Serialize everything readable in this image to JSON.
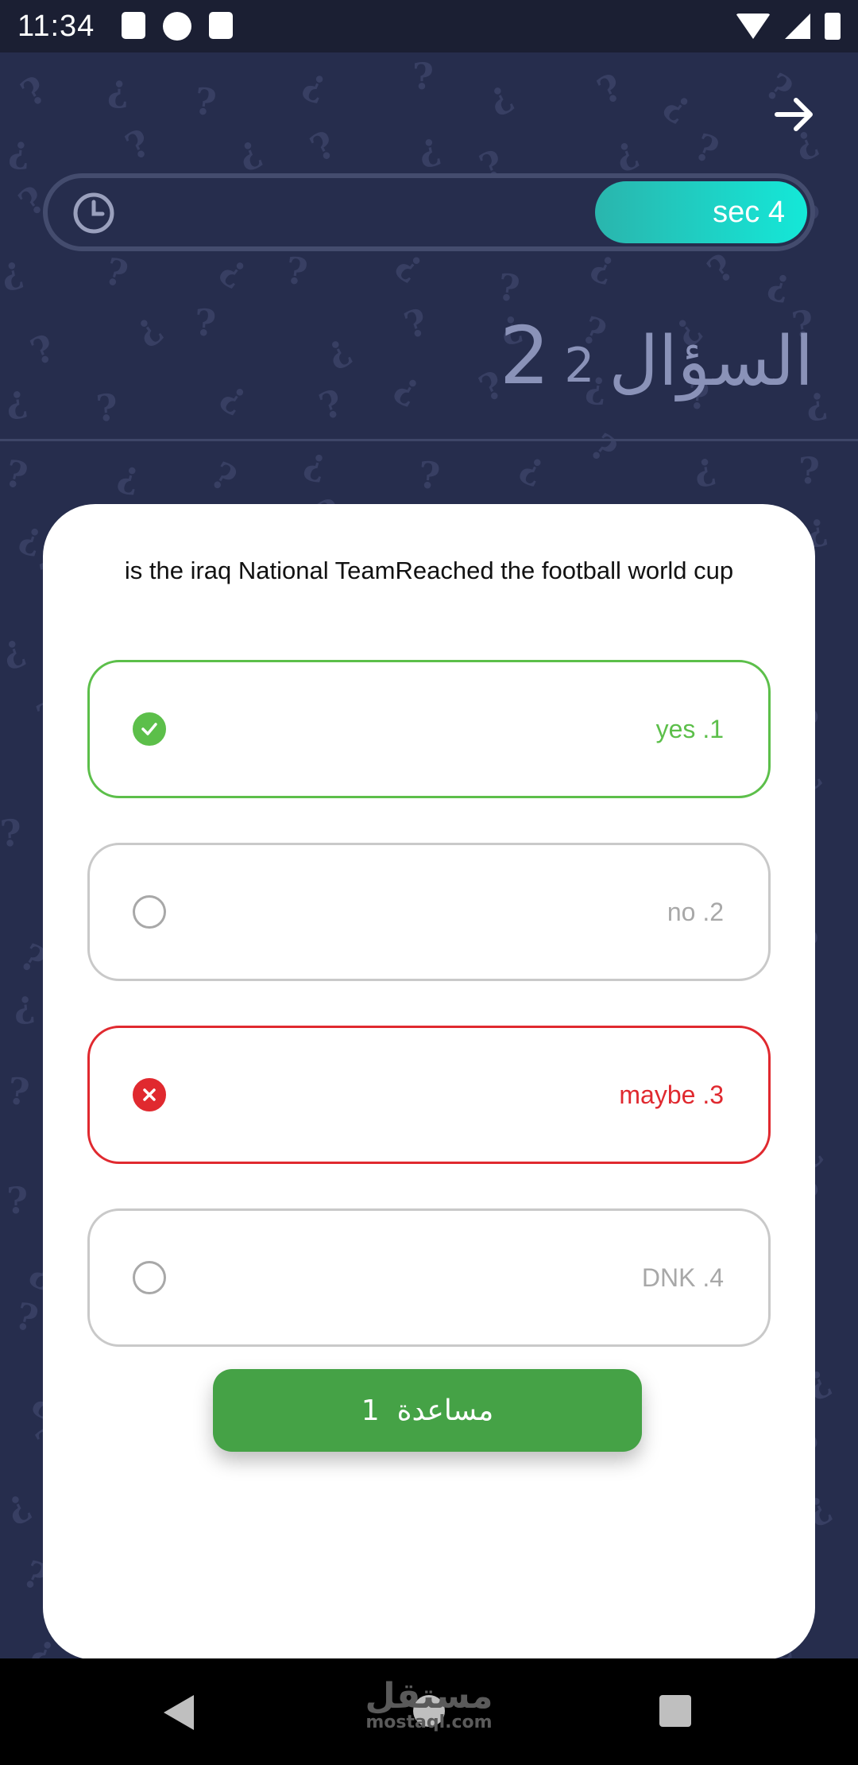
{
  "status_bar": {
    "time": "11:34",
    "icons_left": [
      "text-a-icon",
      "notification-icon",
      "sd-card-icon"
    ],
    "icons_right": [
      "wifi-icon",
      "signal-icon",
      "battery-icon"
    ]
  },
  "header": {
    "back_icon": "arrow-right-icon",
    "timer_icon": "clock-icon",
    "timer_label": "sec 4",
    "timer_fraction_remaining": 0.28,
    "question_word": "السؤال",
    "question_current": "2",
    "question_total": "2"
  },
  "question": {
    "text": "is the iraq National TeamReached the football world cup"
  },
  "answers": [
    {
      "label": "yes .1",
      "state": "correct",
      "mark_icon": "check-icon"
    },
    {
      "label": "no .2",
      "state": "neutral",
      "mark_icon": "empty-radio-icon"
    },
    {
      "label": "maybe .3",
      "state": "wrong",
      "mark_icon": "close-icon"
    },
    {
      "label": "DNK .4",
      "state": "neutral",
      "mark_icon": "empty-radio-icon"
    }
  ],
  "help_button": {
    "label": "مساعدة",
    "count": "1"
  },
  "colors": {
    "background": "#262d4d",
    "correct": "#5cbf4a",
    "wrong": "#e0292f",
    "help": "#45a246",
    "timer_fill": "#14e8d8"
  },
  "watermark": {
    "arabic": "مستقل",
    "latin": "mostaql.com"
  }
}
